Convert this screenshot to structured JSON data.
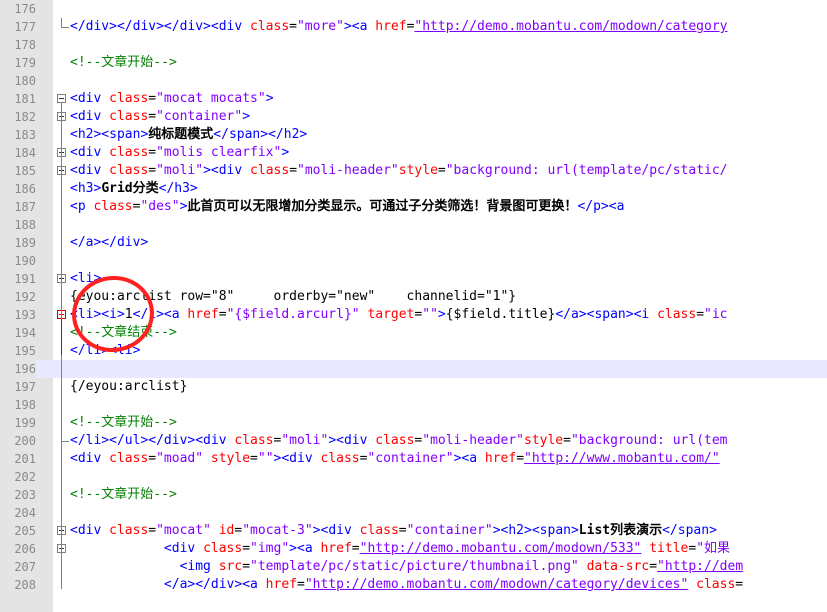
{
  "lines": [
    {
      "n": "176",
      "segs": []
    },
    {
      "n": "177",
      "segs": [
        [
          "t",
          "</div></div></div><div "
        ],
        [
          "a",
          "class"
        ],
        [
          "k",
          "="
        ],
        [
          "v",
          "\"more\""
        ],
        [
          "t",
          "><a "
        ],
        [
          "a",
          "href"
        ],
        [
          "k",
          "="
        ],
        [
          "u",
          "\"http://demo.mobantu.com/modown/category"
        ]
      ]
    },
    {
      "n": "178",
      "segs": []
    },
    {
      "n": "179",
      "segs": [
        [
          "c",
          "<!--文章开始-->"
        ]
      ]
    },
    {
      "n": "180",
      "segs": []
    },
    {
      "n": "181",
      "segs": [
        [
          "t",
          "<div "
        ],
        [
          "a",
          "class"
        ],
        [
          "k",
          "="
        ],
        [
          "v",
          "\"mocat mocats\""
        ],
        [
          "t",
          ">"
        ]
      ]
    },
    {
      "n": "182",
      "segs": [
        [
          "t",
          "<div "
        ],
        [
          "a",
          "class"
        ],
        [
          "k",
          "="
        ],
        [
          "v",
          "\"container\""
        ],
        [
          "t",
          ">"
        ]
      ]
    },
    {
      "n": "183",
      "segs": [
        [
          "t",
          "<h2><span>"
        ],
        [
          "b",
          "纯标题模式"
        ],
        [
          "t",
          "</span></h2>"
        ]
      ]
    },
    {
      "n": "184",
      "segs": [
        [
          "t",
          "<div "
        ],
        [
          "a",
          "class"
        ],
        [
          "k",
          "="
        ],
        [
          "v",
          "\"molis clearfix\""
        ],
        [
          "t",
          ">"
        ]
      ]
    },
    {
      "n": "185",
      "segs": [
        [
          "t",
          "<div "
        ],
        [
          "a",
          "class"
        ],
        [
          "k",
          "="
        ],
        [
          "v",
          "\"moli\""
        ],
        [
          "t",
          "><div "
        ],
        [
          "a",
          "class"
        ],
        [
          "k",
          "="
        ],
        [
          "v",
          "\"moli-header\""
        ],
        [
          "a",
          "style"
        ],
        [
          "k",
          "="
        ],
        [
          "v",
          "\"background: url(template/pc/static/"
        ]
      ]
    },
    {
      "n": "186",
      "segs": [
        [
          "t",
          "<h3>"
        ],
        [
          "b",
          "Grid分类"
        ],
        [
          "t",
          "</h3>"
        ]
      ]
    },
    {
      "n": "187",
      "segs": [
        [
          "t",
          "<p "
        ],
        [
          "a",
          "class"
        ],
        [
          "k",
          "="
        ],
        [
          "v",
          "\"des\""
        ],
        [
          "t",
          ">"
        ],
        [
          "b",
          "此首页可以无限增加分类显示。可通过子分类筛选！背景图可更换！"
        ],
        [
          "t",
          "</p><a"
        ]
      ]
    },
    {
      "n": "188",
      "segs": []
    },
    {
      "n": "189",
      "segs": [
        [
          "t",
          "</a></div>"
        ]
      ]
    },
    {
      "n": "190",
      "segs": []
    },
    {
      "n": "191",
      "segs": [
        [
          "t",
          "<li>"
        ]
      ]
    },
    {
      "n": "192",
      "segs": [
        [
          "k",
          "{eyou:arclist row=\"8\"     orderby=\"new\"    channelid=\"1\"}"
        ]
      ]
    },
    {
      "n": "193",
      "segs": [
        [
          "t",
          "<li><i>"
        ],
        [
          "k",
          "1"
        ],
        [
          "t",
          "</i><a "
        ],
        [
          "a",
          "href"
        ],
        [
          "k",
          "="
        ],
        [
          "v",
          "\"{$field.arcurl}\""
        ],
        [
          "k",
          " "
        ],
        [
          "a",
          "target"
        ],
        [
          "k",
          "="
        ],
        [
          "v",
          "\"\""
        ],
        [
          "t",
          ">"
        ],
        [
          "k",
          "{$field.title}"
        ],
        [
          "t",
          "</a><span><i "
        ],
        [
          "a",
          "class"
        ],
        [
          "k",
          "="
        ],
        [
          "v",
          "\"ic"
        ]
      ]
    },
    {
      "n": "194",
      "segs": [
        [
          "c",
          "<!--文章结束-->"
        ]
      ]
    },
    {
      "n": "195",
      "segs": [
        [
          "t",
          "</li><li>"
        ]
      ]
    },
    {
      "n": "196",
      "segs": []
    },
    {
      "n": "197",
      "segs": [
        [
          "k",
          "{/eyou:arclist}"
        ]
      ]
    },
    {
      "n": "198",
      "segs": []
    },
    {
      "n": "199",
      "segs": [
        [
          "c",
          "<!--文章开始-->"
        ]
      ]
    },
    {
      "n": "200",
      "segs": [
        [
          "t",
          "</li></ul></div><div "
        ],
        [
          "a",
          "class"
        ],
        [
          "k",
          "="
        ],
        [
          "v",
          "\"moli\""
        ],
        [
          "t",
          "><div "
        ],
        [
          "a",
          "class"
        ],
        [
          "k",
          "="
        ],
        [
          "v",
          "\"moli-header\""
        ],
        [
          "a",
          "style"
        ],
        [
          "k",
          "="
        ],
        [
          "v",
          "\"background: url(tem"
        ]
      ]
    },
    {
      "n": "201",
      "segs": [
        [
          "t",
          "<div "
        ],
        [
          "a",
          "class"
        ],
        [
          "k",
          "="
        ],
        [
          "v",
          "\"moad\""
        ],
        [
          "k",
          " "
        ],
        [
          "a",
          "style"
        ],
        [
          "k",
          "="
        ],
        [
          "v",
          "\"\""
        ],
        [
          "t",
          "><div "
        ],
        [
          "a",
          "class"
        ],
        [
          "k",
          "="
        ],
        [
          "v",
          "\"container\""
        ],
        [
          "t",
          "><a "
        ],
        [
          "a",
          "href"
        ],
        [
          "k",
          "="
        ],
        [
          "u",
          "\"http://www.mobantu.com/\""
        ]
      ]
    },
    {
      "n": "202",
      "segs": []
    },
    {
      "n": "203",
      "segs": [
        [
          "c",
          "<!--文章开始-->"
        ]
      ]
    },
    {
      "n": "204",
      "segs": []
    },
    {
      "n": "205",
      "segs": [
        [
          "t",
          "<div "
        ],
        [
          "a",
          "class"
        ],
        [
          "k",
          "="
        ],
        [
          "v",
          "\"mocat\""
        ],
        [
          "k",
          " "
        ],
        [
          "a",
          "id"
        ],
        [
          "k",
          "="
        ],
        [
          "v",
          "\"mocat-3\""
        ],
        [
          "t",
          "><div "
        ],
        [
          "a",
          "class"
        ],
        [
          "k",
          "="
        ],
        [
          "v",
          "\"container\""
        ],
        [
          "t",
          "><h2><span>"
        ],
        [
          "b",
          "List列表演示"
        ],
        [
          "t",
          "</span>"
        ]
      ]
    },
    {
      "n": "206",
      "segs": [
        [
          "k",
          "            "
        ],
        [
          "t",
          "<div "
        ],
        [
          "a",
          "class"
        ],
        [
          "k",
          "="
        ],
        [
          "v",
          "\"img\""
        ],
        [
          "t",
          "><a "
        ],
        [
          "a",
          "href"
        ],
        [
          "k",
          "="
        ],
        [
          "u",
          "\"http://demo.mobantu.com/modown/533\""
        ],
        [
          "k",
          " "
        ],
        [
          "a",
          "title"
        ],
        [
          "k",
          "="
        ],
        [
          "v",
          "\"如果"
        ]
      ]
    },
    {
      "n": "207",
      "segs": [
        [
          "k",
          "              "
        ],
        [
          "t",
          "<img "
        ],
        [
          "a",
          "src"
        ],
        [
          "k",
          "="
        ],
        [
          "v",
          "\"template/pc/static/picture/thumbnail.png\""
        ],
        [
          "k",
          " "
        ],
        [
          "a",
          "data-src"
        ],
        [
          "k",
          "="
        ],
        [
          "u",
          "\"http://dem"
        ]
      ]
    },
    {
      "n": "208",
      "segs": [
        [
          "k",
          "            "
        ],
        [
          "t",
          "</a></div><a "
        ],
        [
          "a",
          "href"
        ],
        [
          "k",
          "="
        ],
        [
          "u",
          "\"http://demo.mobantu.com/modown/category/devices\""
        ],
        [
          "k",
          " "
        ],
        [
          "a",
          "class"
        ],
        [
          "k",
          "="
        ]
      ]
    }
  ]
}
